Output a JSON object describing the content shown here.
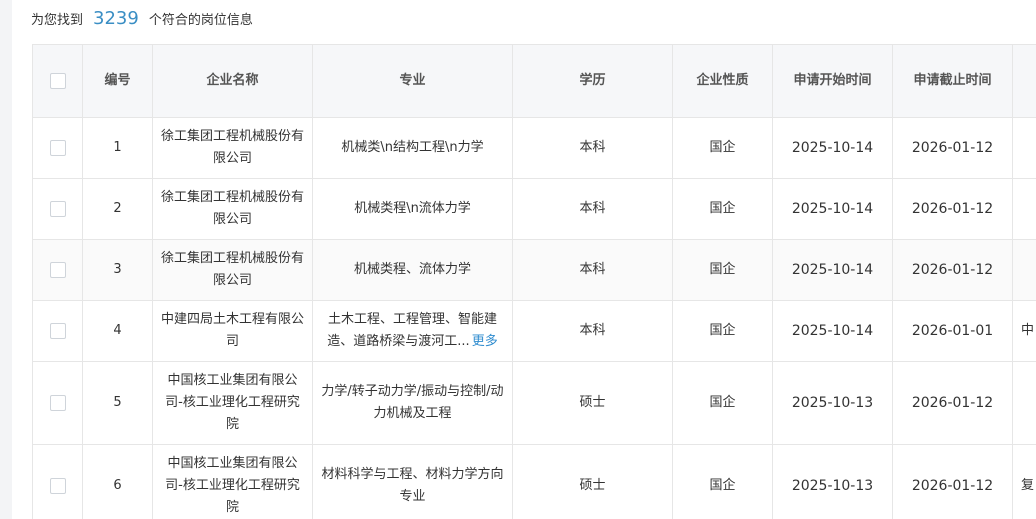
{
  "summary": {
    "prefix": "为您找到",
    "count": "3239",
    "suffix": "个符合的岗位信息"
  },
  "table": {
    "columns": [
      "编号",
      "企业名称",
      "专业",
      "学历",
      "企业性质",
      "申请开始时间",
      "申请截止时间"
    ],
    "rows": [
      {
        "id": "1",
        "company": "徐工集团工程机械股份有限公司",
        "major": "机械类\\n结构工程\\n力学",
        "major_more": "",
        "degree": "本科",
        "nature": "国企",
        "start": "2025-10-14",
        "end": "2026-01-12",
        "extra": ""
      },
      {
        "id": "2",
        "company": "徐工集团工程机械股份有限公司",
        "major": "机械类程\\n流体力学",
        "major_more": "",
        "degree": "本科",
        "nature": "国企",
        "start": "2025-10-14",
        "end": "2026-01-12",
        "extra": ""
      },
      {
        "id": "3",
        "company": "徐工集团工程机械股份有限公司",
        "major": "机械类程、流体力学",
        "major_more": "",
        "degree": "本科",
        "nature": "国企",
        "start": "2025-10-14",
        "end": "2026-01-12",
        "extra": ""
      },
      {
        "id": "4",
        "company": "中建四局土木工程有限公司",
        "major": "土木工程、工程管理、智能建造、道路桥梁与渡河工...",
        "major_more": "更多",
        "degree": "本科",
        "nature": "国企",
        "start": "2025-10-14",
        "end": "2026-01-01",
        "extra": "中 公"
      },
      {
        "id": "5",
        "company": "中国核工业集团有限公司-核工业理化工程研究院",
        "major": "力学/转子动力学/振动与控制/动力机械及工程",
        "major_more": "",
        "degree": "硕士",
        "nature": "国企",
        "start": "2025-10-13",
        "end": "2026-01-12",
        "extra": ""
      },
      {
        "id": "6",
        "company": "中国核工业集团有限公司-核工业理化工程研究院",
        "major": "材料科学与工程、材料力学方向专业",
        "major_more": "",
        "degree": "硕士",
        "nature": "国企",
        "start": "2025-10-13",
        "end": "2026-01-12",
        "extra": "复"
      }
    ]
  }
}
